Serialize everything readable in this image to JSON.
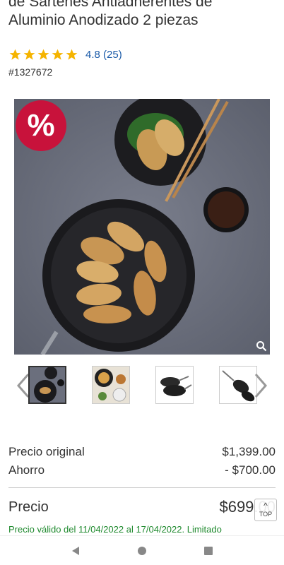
{
  "product": {
    "title_line1": "de Sartenes Antiadherentes de",
    "title_line2": "Aluminio Anodizado 2 piezas",
    "rating_value": 4.8,
    "rating_text": "4.8 (25)",
    "sku": "#1327672"
  },
  "hero": {
    "badge_text": "%",
    "badge_icon": "percent-badge-icon",
    "zoom_icon": "magnifier-icon"
  },
  "thumbnails": [
    {
      "name": "pan-dumplings",
      "active": true
    },
    {
      "name": "food-spread",
      "active": false
    },
    {
      "name": "pan-set-top",
      "active": false
    },
    {
      "name": "pan-set-angle",
      "active": false
    }
  ],
  "pricing": {
    "original_label": "Precio original",
    "original_value": "$1,399.00",
    "savings_label": "Ahorro",
    "savings_value": "- $700.00",
    "price_label": "Precio",
    "price_value": "$699.00",
    "validity": "Precio válido del 11/04/2022 al 17/04/2022. Limitado"
  },
  "top_button": {
    "label": "TOP"
  },
  "colors": {
    "accent_red": "#c8123b",
    "link_blue": "#1a5aa8",
    "star_gold": "#f5b400",
    "valid_green": "#1f8a2e"
  }
}
